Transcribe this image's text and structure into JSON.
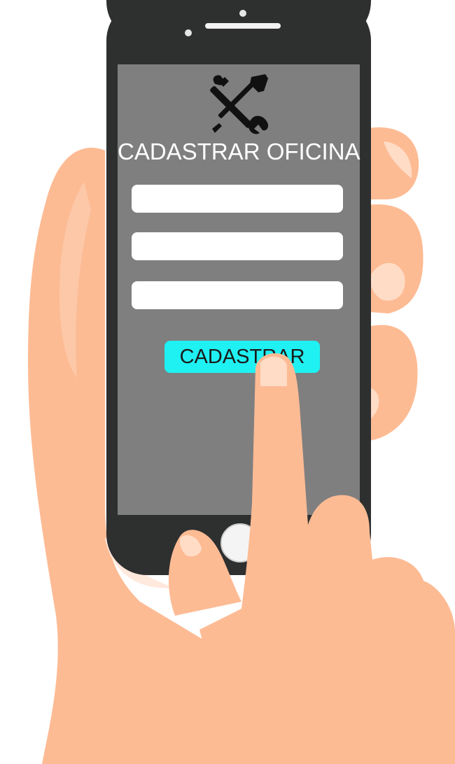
{
  "form": {
    "title": "CADASTRAR OFICINA",
    "fields": [
      {
        "value": "",
        "placeholder": ""
      },
      {
        "value": "",
        "placeholder": ""
      },
      {
        "value": "",
        "placeholder": ""
      }
    ],
    "submit_label": "CADASTRAR",
    "header_icon": "wrench-screwdriver-icon"
  },
  "colors": {
    "screen": "#7f7f7f",
    "phone_body": "#2e2f2f",
    "button": "#1ff0f2",
    "skin": "#fdbb94",
    "skin_light": "#ffdcc6"
  }
}
